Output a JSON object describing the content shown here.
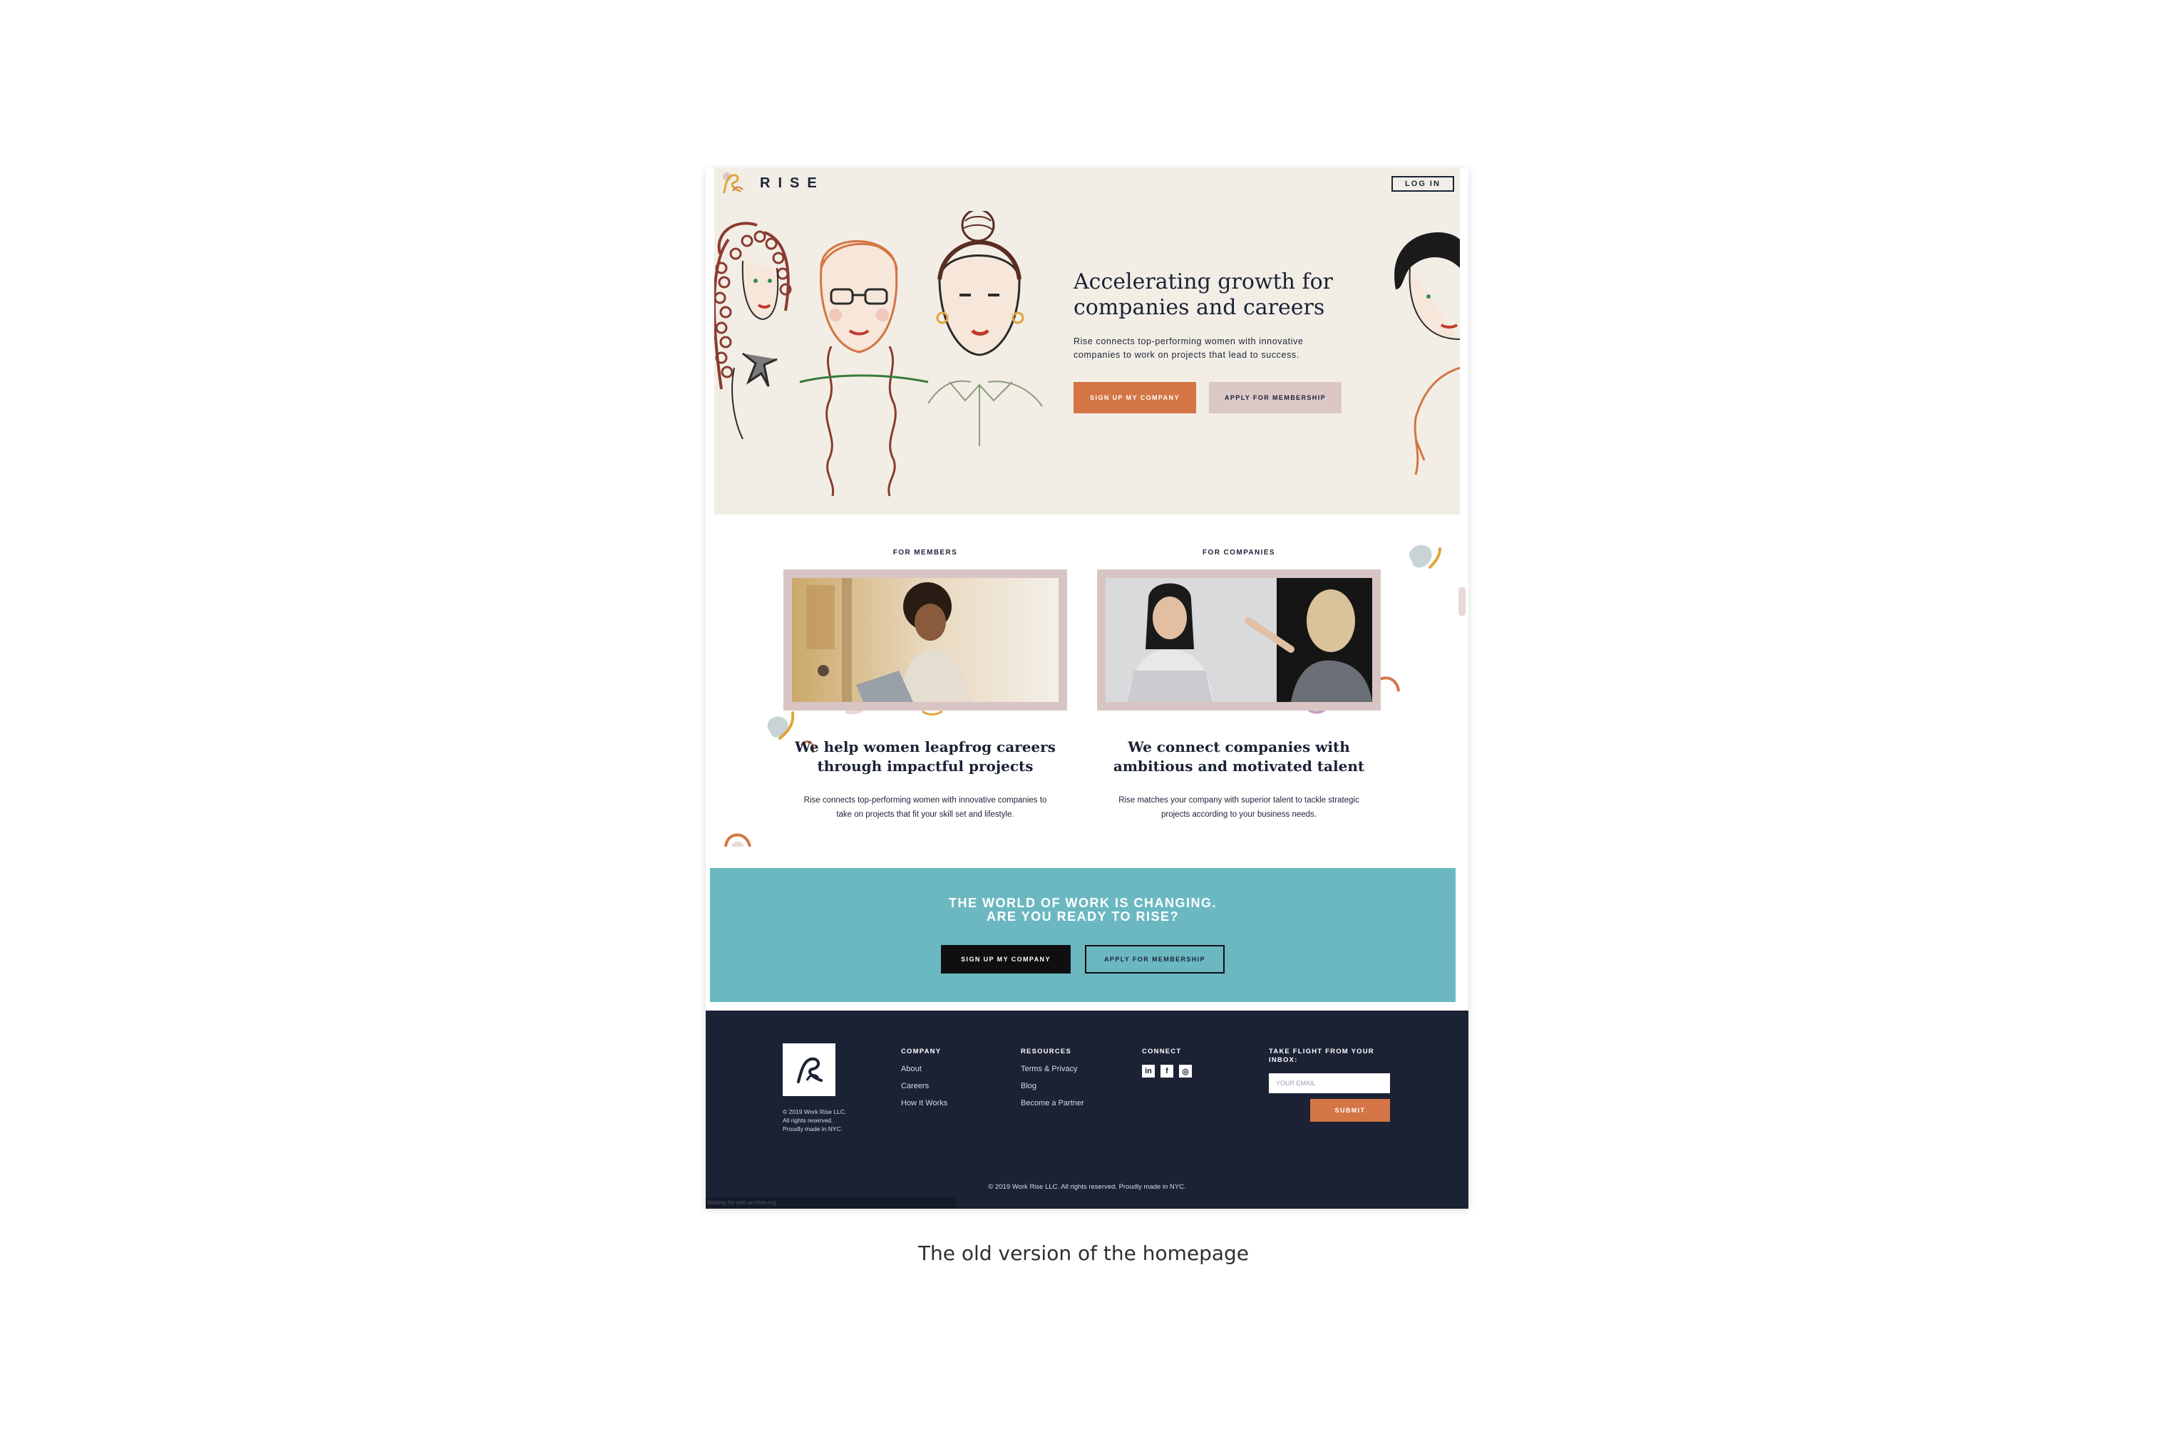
{
  "header": {
    "logo_text": "RISE",
    "login_label": "LOG IN"
  },
  "hero": {
    "title_line1": "Accelerating growth for",
    "title_line2": "companies and careers",
    "subtitle_line1": "Rise connects top-performing women with innovative",
    "subtitle_line2": "companies to work on projects that lead to success.",
    "primary_cta": "SIGN UP MY COMPANY",
    "secondary_cta": "APPLY FOR MEMBERSHIP"
  },
  "features": {
    "members": {
      "label": "FOR MEMBERS",
      "heading_line1": "We help women leapfrog careers",
      "heading_line2": "through impactful projects",
      "text_line1": "Rise connects top-performing women with innovative companies to",
      "text_line2": "take on projects that fit your skill set and lifestyle."
    },
    "companies": {
      "label": "FOR COMPANIES",
      "heading_line1": "We connect companies with",
      "heading_line2": "ambitious and motivated talent",
      "text_line1": "Rise matches your company with superior talent to tackle strategic",
      "text_line2": "projects according to your business needs."
    }
  },
  "cta": {
    "title_line1": "THE WORLD OF WORK IS CHANGING.",
    "title_line2": "ARE YOU READY TO RISE?",
    "primary": "SIGN UP MY COMPANY",
    "secondary": "APPLY FOR MEMBERSHIP"
  },
  "footer": {
    "copyright_line1": "© 2019 Work Rise LLC.",
    "copyright_line2": "All rights reserved.",
    "copyright_line3": "Proudly made in NYC.",
    "company": {
      "heading": "COMPANY",
      "links": [
        "About",
        "Careers",
        "How It Works"
      ]
    },
    "resources": {
      "heading": "RESOURCES",
      "links": [
        "Terms & Privacy",
        "Blog",
        "Become a Partner"
      ]
    },
    "connect": {
      "heading": "CONNECT",
      "icons": [
        "linkedin-icon",
        "facebook-icon",
        "instagram-icon"
      ],
      "glyphs": [
        "in",
        "f",
        "◎"
      ]
    },
    "newsletter": {
      "heading_line1": "TAKE FLIGHT FROM YOUR",
      "heading_line2": "INBOX:",
      "placeholder": "YOUR EMAIL",
      "submit": "SUBMIT"
    },
    "bottom": "© 2019 Work Rise LLC. All rights reserved. Proudly made in NYC."
  },
  "status_bar": "Waiting for web.archive.org...",
  "caption": "The old version of the homepage",
  "colors": {
    "accent_orange": "#d47545",
    "navy": "#1c2235",
    "teal": "#6bb8c1",
    "pink": "#dcc7c7",
    "hero_bg": "#f2eee6"
  }
}
